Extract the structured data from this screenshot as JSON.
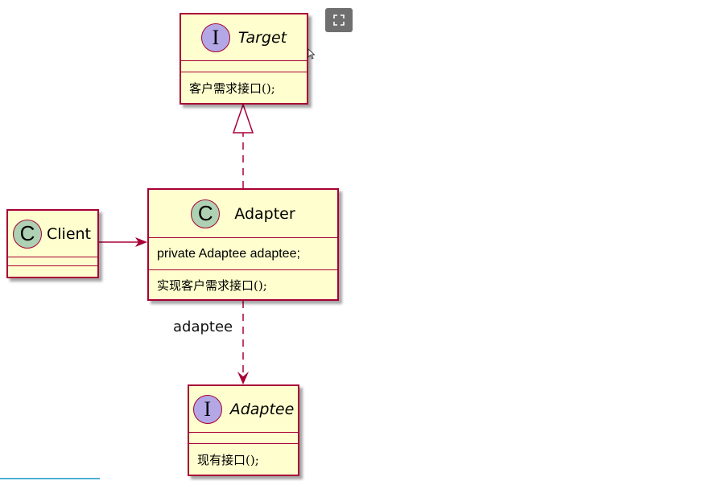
{
  "diagram": {
    "target": {
      "stereotype_letter": "I",
      "name": "Target",
      "methods": [
        "客户需求接口();"
      ]
    },
    "adapter": {
      "stereotype_letter": "C",
      "name": "Adapter",
      "fields": [
        "private Adaptee adaptee;"
      ],
      "methods": [
        "实现客户需求接口();"
      ]
    },
    "client": {
      "stereotype_letter": "C",
      "name": "Client"
    },
    "adaptee": {
      "stereotype_letter": "I",
      "name": "Adaptee",
      "methods": [
        "现有接口();"
      ]
    },
    "relations": {
      "adapter_to_adaptee_label": "adaptee"
    }
  },
  "toolbar": {
    "expand_icon": "expand-icon"
  },
  "colors": {
    "class_fill": "#fefece",
    "border": "#a80036",
    "interface_circle": "#b4a7e5",
    "class_circle": "#add1b2"
  }
}
